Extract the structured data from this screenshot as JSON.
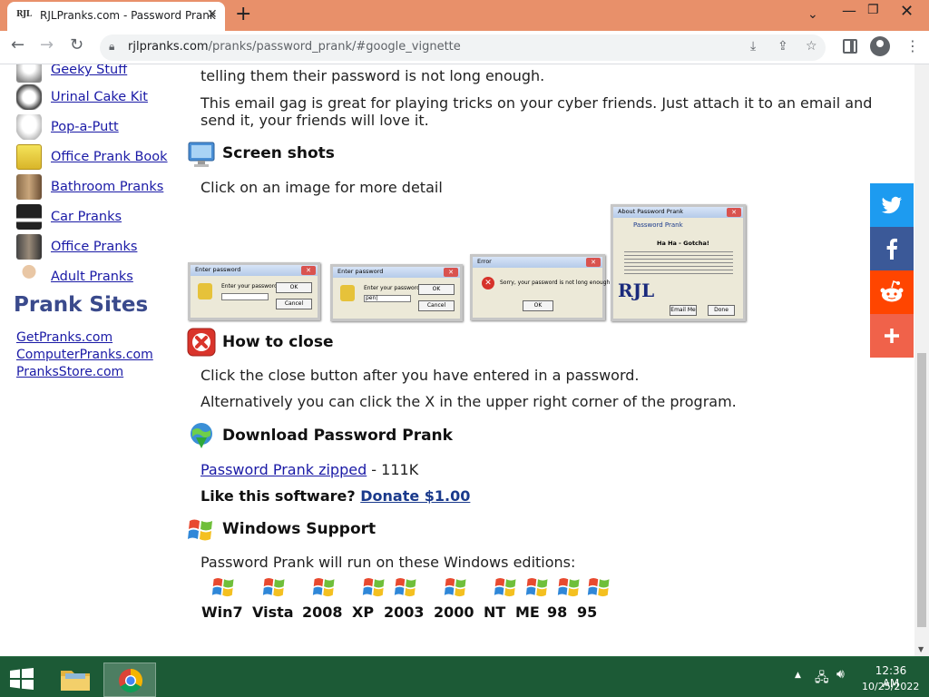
{
  "browser": {
    "tab_favicon": "RJL",
    "tab_title": "RJLPranks.com - Password Prank",
    "tab_close": "✕",
    "new_tab": "+",
    "url_host": "rjlpranks.com",
    "url_path": "/pranks/password_prank/#google_vignette"
  },
  "sidebar": {
    "items": [
      {
        "label": "Geeky Stuff"
      },
      {
        "label": "Urinal Cake Kit"
      },
      {
        "label": "Pop-a-Putt"
      },
      {
        "label": "Office Prank Book"
      },
      {
        "label": "Bathroom Pranks"
      },
      {
        "label": "Car Pranks"
      },
      {
        "label": "Office Pranks"
      },
      {
        "label": "Adult Pranks"
      }
    ],
    "prank_sites_heading": "Prank Sites",
    "sites": [
      "GetPranks.com",
      "ComputerPranks.com",
      "PranksStore.com"
    ]
  },
  "main": {
    "intro_line": "telling them their password is not long enough.",
    "email_para_1": "This email gag is great for playing tricks on your cyber friends. Just attach it to an email and",
    "email_para_2": "send it, your friends will love it.",
    "screenshots_title": "Screen shots",
    "screenshots_hint": "Click on an image for more detail",
    "shot1": {
      "title": "Enter password",
      "prompt": "Enter your password",
      "input": "",
      "ok": "OK",
      "cancel": "Cancel"
    },
    "shot2": {
      "title": "Enter password",
      "prompt": "Enter your password",
      "input": "pen|",
      "ok": "OK",
      "cancel": "Cancel"
    },
    "shot3": {
      "title": "Error",
      "message": "Sorry, your password is not long enough.",
      "ok": "OK"
    },
    "shot4": {
      "title": "About Password Prank",
      "name": "Password Prank",
      "heading": "Ha Ha - Gotcha!",
      "logo": "RJL",
      "ok": "Done",
      "email": "Email Me"
    },
    "close_title": "How to close",
    "close_para_1": "Click the close button after you have entered in a password.",
    "close_para_2": "Alternatively you can click the X in the upper right corner of the program.",
    "download_title": "Download Password Prank",
    "download_link": "Password Prank zipped",
    "download_size": " - 111K",
    "like_text": "Like this software?",
    "donate_link": "Donate $1.00",
    "windows_title": "Windows Support",
    "windows_intro": "Password Prank will run on these Windows editions:",
    "editions": [
      "Win7",
      "Vista",
      "2008",
      "XP",
      "2003",
      "2000",
      "NT",
      "ME",
      "98",
      "95"
    ]
  },
  "share": [
    {
      "name": "twitter",
      "color": "#1d9bf0"
    },
    {
      "name": "facebook",
      "color": "#3b5998"
    },
    {
      "name": "reddit",
      "color": "#ff4500"
    },
    {
      "name": "more",
      "color": "#f0624a"
    }
  ],
  "taskbar": {
    "time": "12:36 AM",
    "date": "10/25/2022"
  }
}
